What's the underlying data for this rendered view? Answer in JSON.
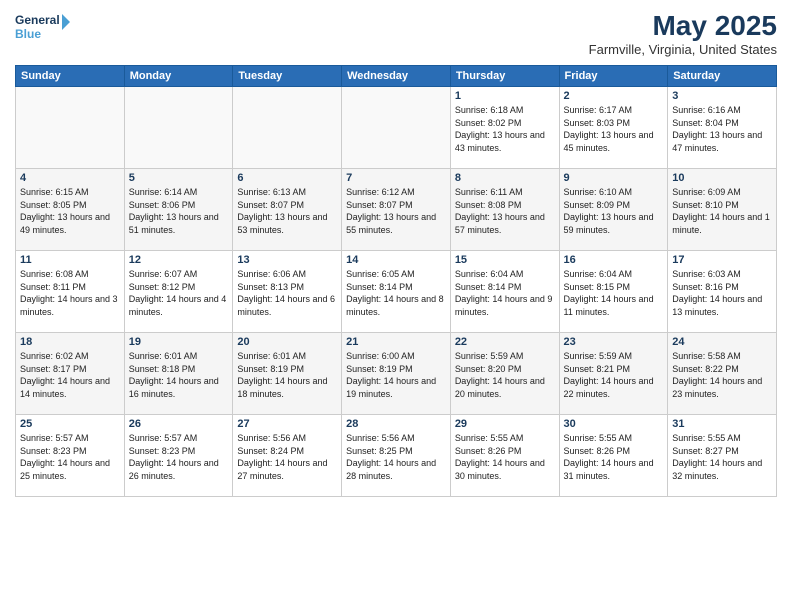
{
  "header": {
    "logo_line1": "General",
    "logo_line2": "Blue",
    "month_year": "May 2025",
    "location": "Farmville, Virginia, United States"
  },
  "days_of_week": [
    "Sunday",
    "Monday",
    "Tuesday",
    "Wednesday",
    "Thursday",
    "Friday",
    "Saturday"
  ],
  "weeks": [
    [
      {
        "day": "",
        "sunrise": "",
        "sunset": "",
        "daylight": ""
      },
      {
        "day": "",
        "sunrise": "",
        "sunset": "",
        "daylight": ""
      },
      {
        "day": "",
        "sunrise": "",
        "sunset": "",
        "daylight": ""
      },
      {
        "day": "",
        "sunrise": "",
        "sunset": "",
        "daylight": ""
      },
      {
        "day": "1",
        "sunrise": "Sunrise: 6:18 AM",
        "sunset": "Sunset: 8:02 PM",
        "daylight": "Daylight: 13 hours and 43 minutes."
      },
      {
        "day": "2",
        "sunrise": "Sunrise: 6:17 AM",
        "sunset": "Sunset: 8:03 PM",
        "daylight": "Daylight: 13 hours and 45 minutes."
      },
      {
        "day": "3",
        "sunrise": "Sunrise: 6:16 AM",
        "sunset": "Sunset: 8:04 PM",
        "daylight": "Daylight: 13 hours and 47 minutes."
      }
    ],
    [
      {
        "day": "4",
        "sunrise": "Sunrise: 6:15 AM",
        "sunset": "Sunset: 8:05 PM",
        "daylight": "Daylight: 13 hours and 49 minutes."
      },
      {
        "day": "5",
        "sunrise": "Sunrise: 6:14 AM",
        "sunset": "Sunset: 8:06 PM",
        "daylight": "Daylight: 13 hours and 51 minutes."
      },
      {
        "day": "6",
        "sunrise": "Sunrise: 6:13 AM",
        "sunset": "Sunset: 8:07 PM",
        "daylight": "Daylight: 13 hours and 53 minutes."
      },
      {
        "day": "7",
        "sunrise": "Sunrise: 6:12 AM",
        "sunset": "Sunset: 8:07 PM",
        "daylight": "Daylight: 13 hours and 55 minutes."
      },
      {
        "day": "8",
        "sunrise": "Sunrise: 6:11 AM",
        "sunset": "Sunset: 8:08 PM",
        "daylight": "Daylight: 13 hours and 57 minutes."
      },
      {
        "day": "9",
        "sunrise": "Sunrise: 6:10 AM",
        "sunset": "Sunset: 8:09 PM",
        "daylight": "Daylight: 13 hours and 59 minutes."
      },
      {
        "day": "10",
        "sunrise": "Sunrise: 6:09 AM",
        "sunset": "Sunset: 8:10 PM",
        "daylight": "Daylight: 14 hours and 1 minute."
      }
    ],
    [
      {
        "day": "11",
        "sunrise": "Sunrise: 6:08 AM",
        "sunset": "Sunset: 8:11 PM",
        "daylight": "Daylight: 14 hours and 3 minutes."
      },
      {
        "day": "12",
        "sunrise": "Sunrise: 6:07 AM",
        "sunset": "Sunset: 8:12 PM",
        "daylight": "Daylight: 14 hours and 4 minutes."
      },
      {
        "day": "13",
        "sunrise": "Sunrise: 6:06 AM",
        "sunset": "Sunset: 8:13 PM",
        "daylight": "Daylight: 14 hours and 6 minutes."
      },
      {
        "day": "14",
        "sunrise": "Sunrise: 6:05 AM",
        "sunset": "Sunset: 8:14 PM",
        "daylight": "Daylight: 14 hours and 8 minutes."
      },
      {
        "day": "15",
        "sunrise": "Sunrise: 6:04 AM",
        "sunset": "Sunset: 8:14 PM",
        "daylight": "Daylight: 14 hours and 9 minutes."
      },
      {
        "day": "16",
        "sunrise": "Sunrise: 6:04 AM",
        "sunset": "Sunset: 8:15 PM",
        "daylight": "Daylight: 14 hours and 11 minutes."
      },
      {
        "day": "17",
        "sunrise": "Sunrise: 6:03 AM",
        "sunset": "Sunset: 8:16 PM",
        "daylight": "Daylight: 14 hours and 13 minutes."
      }
    ],
    [
      {
        "day": "18",
        "sunrise": "Sunrise: 6:02 AM",
        "sunset": "Sunset: 8:17 PM",
        "daylight": "Daylight: 14 hours and 14 minutes."
      },
      {
        "day": "19",
        "sunrise": "Sunrise: 6:01 AM",
        "sunset": "Sunset: 8:18 PM",
        "daylight": "Daylight: 14 hours and 16 minutes."
      },
      {
        "day": "20",
        "sunrise": "Sunrise: 6:01 AM",
        "sunset": "Sunset: 8:19 PM",
        "daylight": "Daylight: 14 hours and 18 minutes."
      },
      {
        "day": "21",
        "sunrise": "Sunrise: 6:00 AM",
        "sunset": "Sunset: 8:19 PM",
        "daylight": "Daylight: 14 hours and 19 minutes."
      },
      {
        "day": "22",
        "sunrise": "Sunrise: 5:59 AM",
        "sunset": "Sunset: 8:20 PM",
        "daylight": "Daylight: 14 hours and 20 minutes."
      },
      {
        "day": "23",
        "sunrise": "Sunrise: 5:59 AM",
        "sunset": "Sunset: 8:21 PM",
        "daylight": "Daylight: 14 hours and 22 minutes."
      },
      {
        "day": "24",
        "sunrise": "Sunrise: 5:58 AM",
        "sunset": "Sunset: 8:22 PM",
        "daylight": "Daylight: 14 hours and 23 minutes."
      }
    ],
    [
      {
        "day": "25",
        "sunrise": "Sunrise: 5:57 AM",
        "sunset": "Sunset: 8:23 PM",
        "daylight": "Daylight: 14 hours and 25 minutes."
      },
      {
        "day": "26",
        "sunrise": "Sunrise: 5:57 AM",
        "sunset": "Sunset: 8:23 PM",
        "daylight": "Daylight: 14 hours and 26 minutes."
      },
      {
        "day": "27",
        "sunrise": "Sunrise: 5:56 AM",
        "sunset": "Sunset: 8:24 PM",
        "daylight": "Daylight: 14 hours and 27 minutes."
      },
      {
        "day": "28",
        "sunrise": "Sunrise: 5:56 AM",
        "sunset": "Sunset: 8:25 PM",
        "daylight": "Daylight: 14 hours and 28 minutes."
      },
      {
        "day": "29",
        "sunrise": "Sunrise: 5:55 AM",
        "sunset": "Sunset: 8:26 PM",
        "daylight": "Daylight: 14 hours and 30 minutes."
      },
      {
        "day": "30",
        "sunrise": "Sunrise: 5:55 AM",
        "sunset": "Sunset: 8:26 PM",
        "daylight": "Daylight: 14 hours and 31 minutes."
      },
      {
        "day": "31",
        "sunrise": "Sunrise: 5:55 AM",
        "sunset": "Sunset: 8:27 PM",
        "daylight": "Daylight: 14 hours and 32 minutes."
      }
    ]
  ]
}
